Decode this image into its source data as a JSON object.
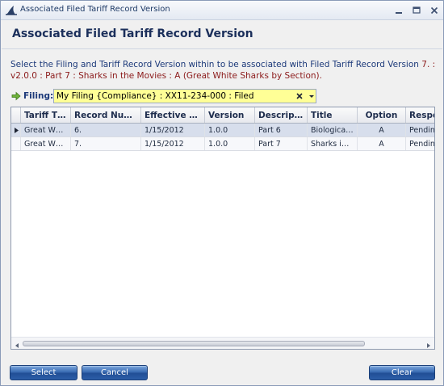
{
  "window": {
    "title": "Associated Filed Tariff Record Version"
  },
  "header": {
    "heading": "Associated Filed Tariff Record Version",
    "instructions_prefix": "Select the Filing and Tariff Record Version within to be associated with Filed Tariff Record Version",
    "instructions_highlight": "7. : v2.0.0 : Part 7 : Sharks in the Movies : A (Great White Sharks by Section)",
    "instructions_suffix": "."
  },
  "filing": {
    "label": "Filing:",
    "value": "My Filing {Compliance} : XX11-234-000 : Filed"
  },
  "grid": {
    "columns": [
      "Tariff Title",
      "Record Number",
      "Effective Date",
      "Version",
      "Description",
      "Title",
      "Option",
      "Respo"
    ],
    "rows": [
      {
        "tariff_title": "Great White Sharks",
        "record_number": "6.",
        "effective_date": "1/15/2012",
        "version": "1.0.0",
        "description": "Part 6",
        "title": "Biological Characteristics",
        "option": "A",
        "response": "Pending"
      },
      {
        "tariff_title": "Great White Sharks",
        "record_number": "7.",
        "effective_date": "1/15/2012",
        "version": "1.0.0",
        "description": "Part 7",
        "title": "Sharks in the Movies",
        "option": "A",
        "response": "Pending"
      }
    ]
  },
  "buttons": {
    "select": "Select",
    "cancel": "Cancel",
    "clear": "Clear"
  },
  "colors": {
    "accent": "#2c5ea8",
    "highlight_text": "#8b1a1a",
    "combo_bg": "#ffff96"
  },
  "icons": {
    "app": "shark-fin-icon",
    "filing_arrow": "arrow-right-icon",
    "combo_clear": "close-icon",
    "combo_drop": "dropdown-icon"
  }
}
